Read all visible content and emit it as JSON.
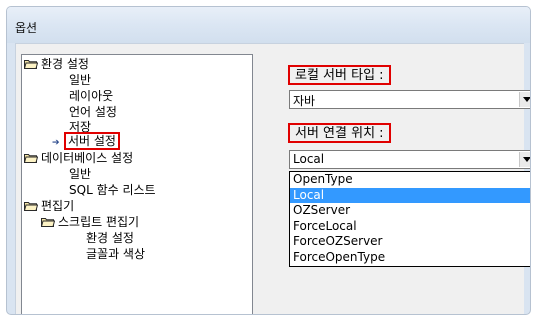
{
  "window": {
    "title": "옵션"
  },
  "tree": {
    "items": [
      {
        "label": "환경 설정"
      },
      {
        "label": "일반"
      },
      {
        "label": "레이아웃"
      },
      {
        "label": "언어 설정"
      },
      {
        "label": "저장"
      },
      {
        "label": "서버 설정"
      },
      {
        "label": "데이터베이스 설정"
      },
      {
        "label": "일반"
      },
      {
        "label": "SQL 함수 리스트"
      },
      {
        "label": "편집기"
      },
      {
        "label": "스크립트 편집기"
      },
      {
        "label": "환경 설정"
      },
      {
        "label": "글꼴과 색상"
      }
    ]
  },
  "server_type": {
    "label": "로컬 서버 타입 :",
    "value": "자바"
  },
  "server_location": {
    "label": "서버 연결 위치 :",
    "value": "Local",
    "options": [
      "OpenType",
      "Local",
      "OZServer",
      "ForceLocal",
      "ForceOZServer",
      "ForceOpenType"
    ]
  },
  "colors": {
    "highlight_border": "#e00000",
    "selection": "#3399ff"
  }
}
